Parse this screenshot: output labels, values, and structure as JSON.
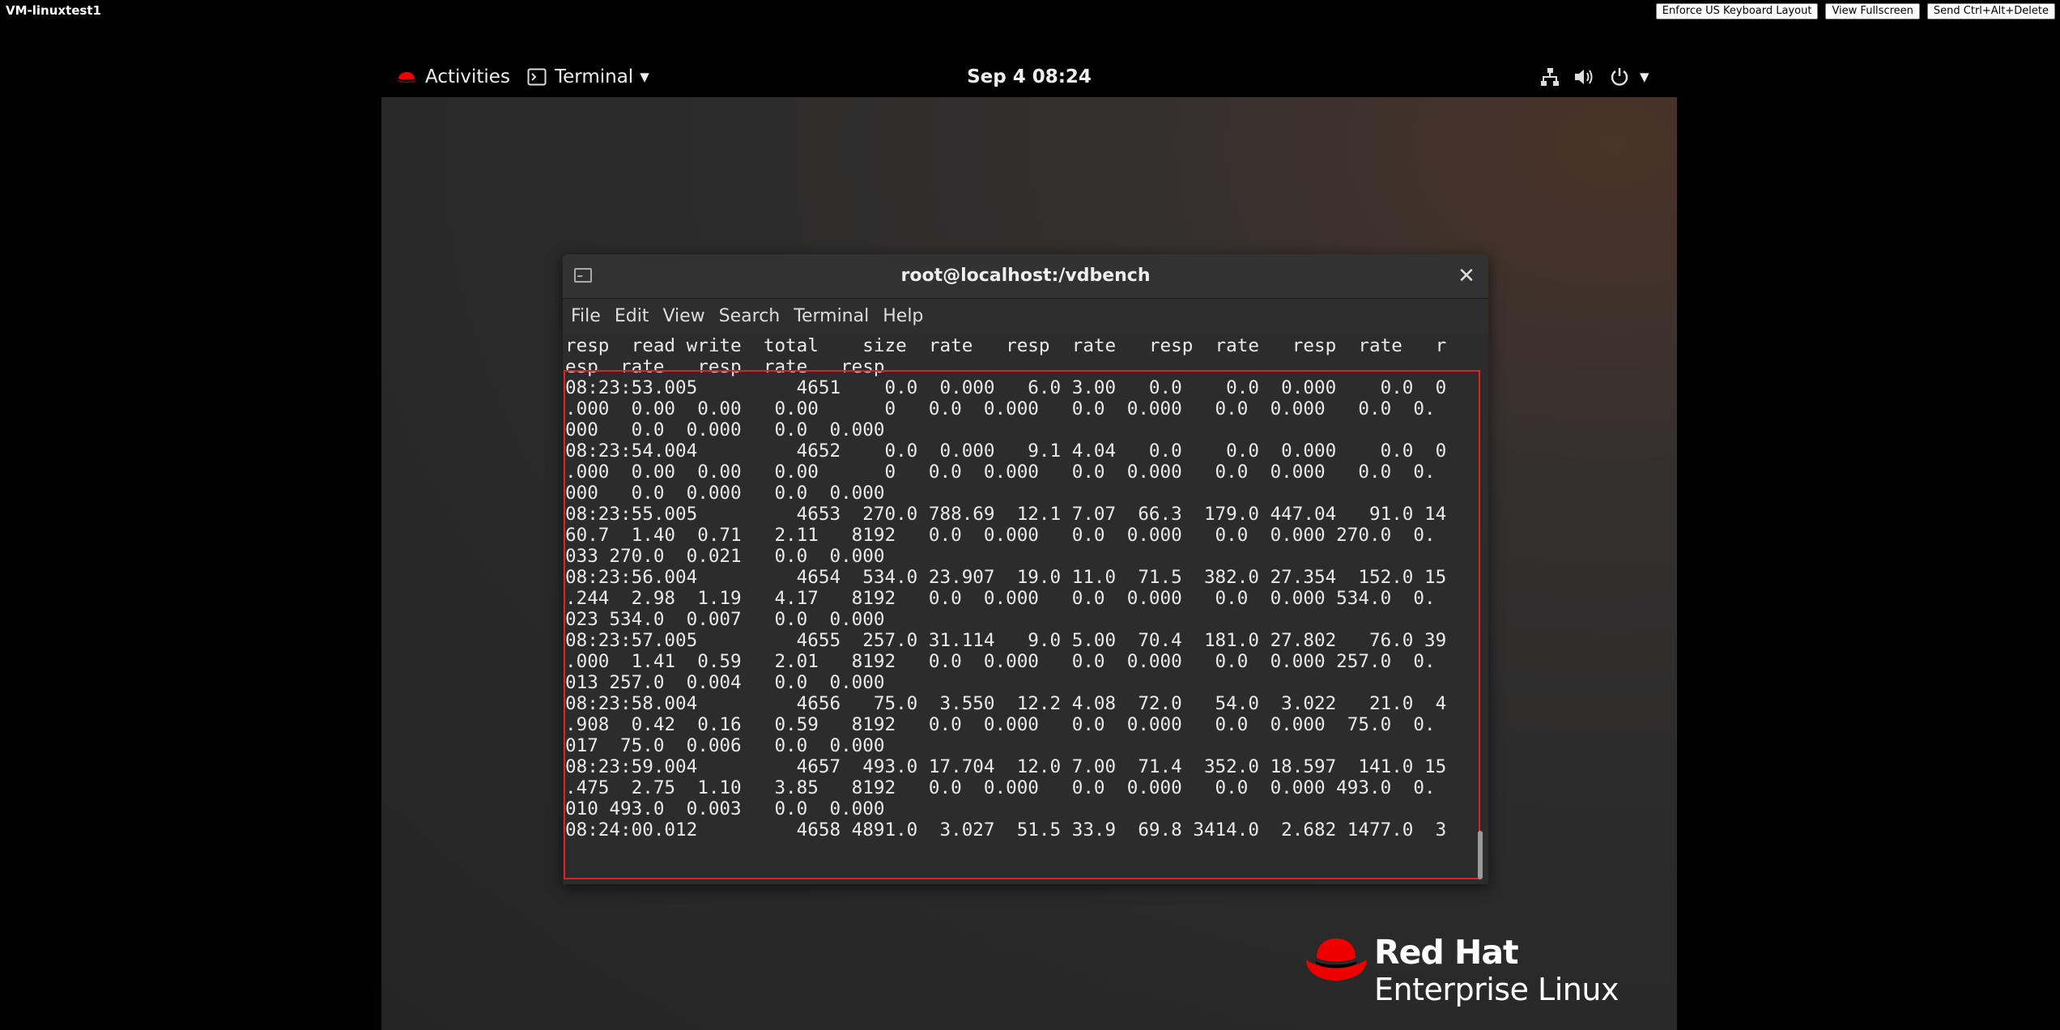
{
  "vm": {
    "title": "VM-linuxtest1",
    "buttons": [
      "Enforce US Keyboard Layout",
      "View Fullscreen",
      "Send Ctrl+Alt+Delete"
    ]
  },
  "topbar": {
    "activities": "Activities",
    "app_menu": "Terminal",
    "clock": "Sep 4  08:24"
  },
  "terminal": {
    "title": "root@localhost:/vdbench",
    "menu": [
      "File",
      "Edit",
      "View",
      "Search",
      "Terminal",
      "Help"
    ],
    "lines": [
      "resp  read write  total    size  rate   resp  rate   resp  rate   resp  rate   r",
      "esp  rate   resp  rate   resp",
      "08:23:53.005         4651    0.0  0.000   6.0 3.00   0.0    0.0  0.000    0.0  0",
      ".000  0.00  0.00   0.00      0   0.0  0.000   0.0  0.000   0.0  0.000   0.0  0.",
      "000   0.0  0.000   0.0  0.000",
      "08:23:54.004         4652    0.0  0.000   9.1 4.04   0.0    0.0  0.000    0.0  0",
      ".000  0.00  0.00   0.00      0   0.0  0.000   0.0  0.000   0.0  0.000   0.0  0.",
      "000   0.0  0.000   0.0  0.000",
      "08:23:55.005         4653  270.0 788.69  12.1 7.07  66.3  179.0 447.04   91.0 14",
      "60.7  1.40  0.71   2.11   8192   0.0  0.000   0.0  0.000   0.0  0.000 270.0  0.",
      "033 270.0  0.021   0.0  0.000",
      "08:23:56.004         4654  534.0 23.907  19.0 11.0  71.5  382.0 27.354  152.0 15",
      ".244  2.98  1.19   4.17   8192   0.0  0.000   0.0  0.000   0.0  0.000 534.0  0.",
      "023 534.0  0.007   0.0  0.000",
      "08:23:57.005         4655  257.0 31.114   9.0 5.00  70.4  181.0 27.802   76.0 39",
      ".000  1.41  0.59   2.01   8192   0.0  0.000   0.0  0.000   0.0  0.000 257.0  0.",
      "013 257.0  0.004   0.0  0.000",
      "08:23:58.004         4656   75.0  3.550  12.2 4.08  72.0   54.0  3.022   21.0  4",
      ".908  0.42  0.16   0.59   8192   0.0  0.000   0.0  0.000   0.0  0.000  75.0  0.",
      "017  75.0  0.006   0.0  0.000",
      "08:23:59.004         4657  493.0 17.704  12.0 7.00  71.4  352.0 18.597  141.0 15",
      ".475  2.75  1.10   3.85   8192   0.0  0.000   0.0  0.000   0.0  0.000 493.0  0.",
      "010 493.0  0.003   0.0  0.000",
      "08:24:00.012         4658 4891.0  3.027  51.5 33.9  69.8 3414.0  2.682 1477.0  3"
    ]
  },
  "logo": {
    "line1": "Red Hat",
    "line2": "Enterprise Linux",
    "color": "#ee0000"
  }
}
